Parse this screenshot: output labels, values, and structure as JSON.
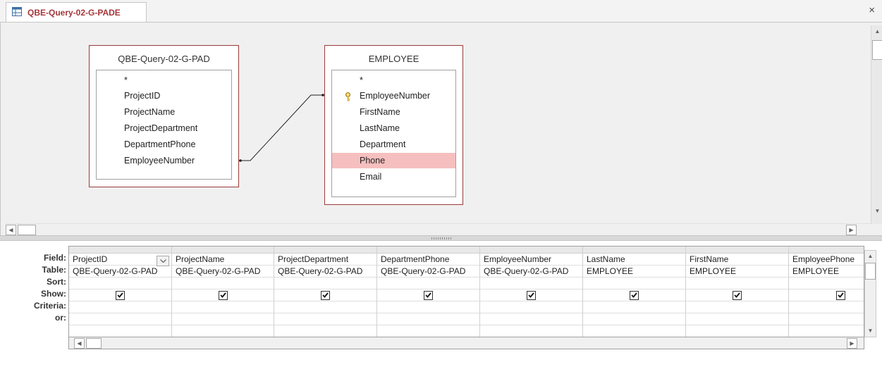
{
  "tab": {
    "title": "QBE-Query-02-G-PADE",
    "icon": "query-icon",
    "close_glyph": "×"
  },
  "design": {
    "tables": [
      {
        "name": "QBE-Query-02-G-PAD",
        "fields": [
          "*",
          "ProjectID",
          "ProjectName",
          "ProjectDepartment",
          "DepartmentPhone",
          "EmployeeNumber"
        ]
      },
      {
        "name": "EMPLOYEE",
        "fields": [
          "*",
          "EmployeeNumber",
          "FirstName",
          "LastName",
          "Department",
          "Phone",
          "Email"
        ],
        "primary_key": "EmployeeNumber",
        "selected": "Phone"
      }
    ],
    "relationship": {
      "from": "QBE-Query-02-G-PAD.EmployeeNumber",
      "to": "EMPLOYEE.EmployeeNumber"
    }
  },
  "grid": {
    "row_labels": [
      "Field:",
      "Table:",
      "Sort:",
      "Show:",
      "Criteria:",
      "or:"
    ],
    "columns": [
      {
        "field": "ProjectID",
        "table": "QBE-Query-02-G-PAD",
        "show": true,
        "has_dropdown": true
      },
      {
        "field": "ProjectName",
        "table": "QBE-Query-02-G-PAD",
        "show": true
      },
      {
        "field": "ProjectDepartment",
        "table": "QBE-Query-02-G-PAD",
        "show": true
      },
      {
        "field": "DepartmentPhone",
        "table": "QBE-Query-02-G-PAD",
        "show": true
      },
      {
        "field": "EmployeeNumber",
        "table": "QBE-Query-02-G-PAD",
        "show": true
      },
      {
        "field": "LastName",
        "table": "EMPLOYEE",
        "show": true
      },
      {
        "field": "FirstName",
        "table": "EMPLOYEE",
        "show": true
      },
      {
        "field": "EmployeePhone",
        "table": "EMPLOYEE",
        "show": true
      }
    ]
  },
  "colors": {
    "tab_text": "#a4373a",
    "table_border": "#9b3b3b",
    "selected_row": "#f6bfbf"
  }
}
